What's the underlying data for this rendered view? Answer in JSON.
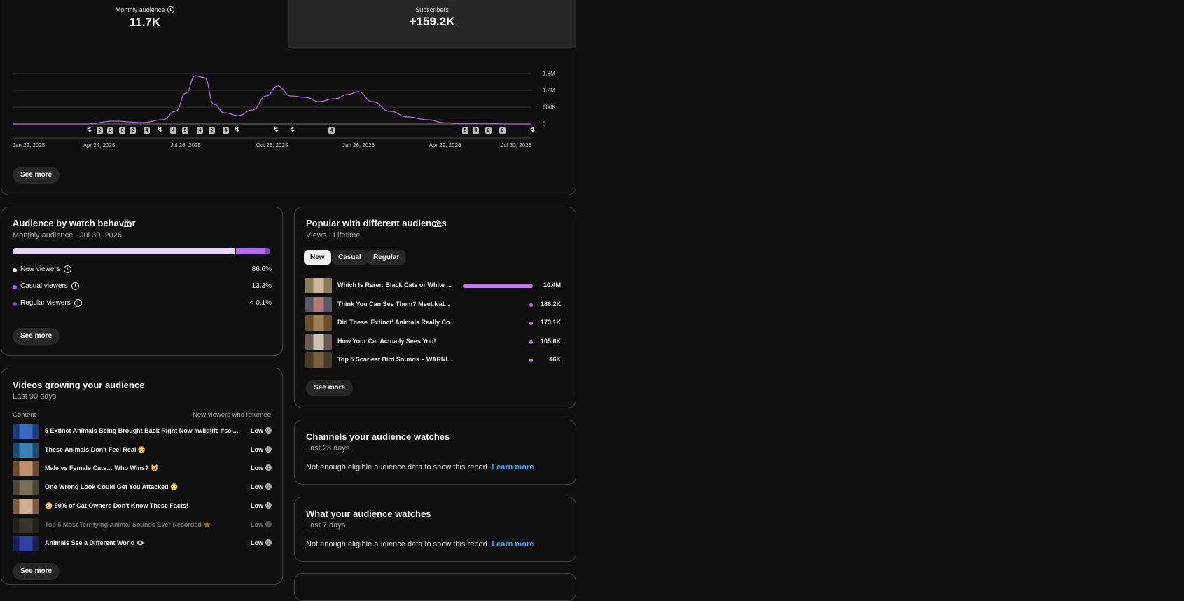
{
  "metrics": [
    {
      "label": "Monthly audience",
      "value": "11.7K"
    },
    {
      "label": "Subscribers",
      "value": "+159.2K"
    }
  ],
  "chart_data": {
    "type": "line",
    "series": [
      {
        "x": [
          "2025-01-22",
          "2025-02-15",
          "2025-03-15",
          "2025-04-10",
          "2025-05-10",
          "2025-06-10",
          "2025-07-01",
          "2025-07-15",
          "2025-07-26",
          "2025-08-05",
          "2025-08-15",
          "2025-08-25",
          "2025-09-05",
          "2025-09-20",
          "2025-10-05",
          "2025-10-20",
          "2025-11-01",
          "2025-11-15",
          "2025-12-01",
          "2025-12-15",
          "2026-01-01",
          "2026-01-15",
          "2026-01-26",
          "2026-02-10",
          "2026-03-01",
          "2026-03-20",
          "2026-04-10",
          "2026-04-29",
          "2026-05-20",
          "2026-06-10",
          "2026-07-01",
          "2026-07-30"
        ],
        "values": [
          0,
          0,
          0,
          0,
          100000,
          50000,
          150000,
          450000,
          1100000,
          1720000,
          1650000,
          700000,
          400000,
          300000,
          500000,
          1000000,
          1350000,
          1000000,
          950000,
          800000,
          900000,
          1050000,
          1150000,
          800000,
          450000,
          250000,
          150000,
          40000,
          20000,
          30000,
          0,
          0
        ]
      }
    ],
    "xticks": [
      "Jan 22, 2025",
      "Apr 24, 2025",
      "Jul 26, 2025",
      "Oct 26, 2025",
      "Jan 26, 2026",
      "Apr 29, 2026",
      "Jul 30, 2026"
    ],
    "yticks": [
      "1.8M",
      "1.2M",
      "600K",
      "0"
    ],
    "ylim": [
      0,
      1800000
    ],
    "grid": true,
    "line_color": "#b46bea",
    "event_markers": [
      {
        "kind": "short",
        "label": ""
      },
      {
        "kind": "num",
        "label": "2"
      },
      {
        "kind": "num",
        "label": "3"
      },
      {
        "kind": "num",
        "label": "3"
      },
      {
        "kind": "num",
        "label": "2"
      },
      {
        "kind": "num",
        "label": "4"
      },
      {
        "kind": "short",
        "label": ""
      },
      {
        "kind": "num",
        "label": "4"
      },
      {
        "kind": "num",
        "label": "5"
      },
      {
        "kind": "num",
        "label": "4"
      },
      {
        "kind": "num",
        "label": "2"
      },
      {
        "kind": "num",
        "label": "4"
      },
      {
        "kind": "short",
        "label": ""
      },
      {
        "kind": "short",
        "label": ""
      },
      {
        "kind": "short",
        "label": ""
      },
      {
        "kind": "num",
        "label": "4"
      },
      {
        "kind": "num",
        "label": "5"
      },
      {
        "kind": "num",
        "label": "4"
      },
      {
        "kind": "num",
        "label": "2"
      },
      {
        "kind": "num",
        "label": "2"
      },
      {
        "kind": "short",
        "label": ""
      }
    ]
  },
  "overview": {
    "see_more": "See more"
  },
  "behavior": {
    "title": "Audience by watch behavior",
    "subtitle": "Monthly audience · Jul 30, 2026",
    "segments": [
      {
        "fraction": 0.866,
        "color": "#e9d5f7"
      },
      {
        "fraction": 0.133,
        "color": "#b46bea"
      },
      {
        "fraction": 0.001,
        "color": "#8a3fc0"
      }
    ],
    "rows": [
      {
        "label": "New viewers",
        "value": "86.6%",
        "color": "#ffffff"
      },
      {
        "label": "Casual viewers",
        "value": "13.3%",
        "color": "#b46bea"
      },
      {
        "label": "Regular viewers",
        "value": "< 0.1%",
        "color": "#8a3fc0"
      }
    ],
    "see_more": "See more"
  },
  "popular": {
    "title": "Popular with different audiences",
    "subtitle": "Views · Lifetime",
    "tabs": [
      "New",
      "Casual",
      "Regular"
    ],
    "active_tab": "New",
    "rows": [
      {
        "title": "Which Is Rarer: Black Cats or White ...",
        "value": "10.4M",
        "fraction": 1.0
      },
      {
        "title": "Think You Can See Them? Meet Nat...",
        "value": "186.2K",
        "fraction": 0.018
      },
      {
        "title": "Did These 'Extinct' Animals Really Co...",
        "value": "173.1K",
        "fraction": 0.017
      },
      {
        "title": "How Your Cat Actually Sees You!",
        "value": "105.6K",
        "fraction": 0.01
      },
      {
        "title": "Top 5 Scariest Bird Sounds – WARNI...",
        "value": "46K",
        "fraction": 0.004
      }
    ],
    "see_more": "See more"
  },
  "growing": {
    "title": "Videos growing your audience",
    "subtitle": "Last 90 days",
    "col_content": "Content",
    "col_metric": "New viewers who returned",
    "rows": [
      {
        "title": "5 Extinct Animals Being Brought Back Right Now #wildlife #sci...",
        "level": "Low",
        "dim": false
      },
      {
        "title": "These Animals Don't Feel Real 😳",
        "level": "Low",
        "dim": false
      },
      {
        "title": "Male vs Female Cats… Who Wins? 🐱",
        "level": "Low",
        "dim": false
      },
      {
        "title": "One Wrong Look Could Get You Attacked 😳",
        "level": "Low",
        "dim": false
      },
      {
        "title": "😳 99% of Cat Owners Don't Know These Facts!",
        "level": "Low",
        "dim": false
      },
      {
        "title": "Top 5 Most Terrifying Animal Sounds Ever Recorded ⭐",
        "level": "Low",
        "dim": true
      },
      {
        "title": "Animals See a Different World 👁️",
        "level": "Low",
        "dim": false
      }
    ],
    "see_more": "See more"
  },
  "channels": {
    "title": "Channels your audience watches",
    "subtitle": "Last 28 days",
    "message": "Not enough eligible audience data to show this report.",
    "link": "Learn more"
  },
  "watches": {
    "title": "What your audience watches",
    "subtitle": "Last 7 days",
    "message": "Not enough eligible audience data to show this report.",
    "link": "Learn more"
  }
}
